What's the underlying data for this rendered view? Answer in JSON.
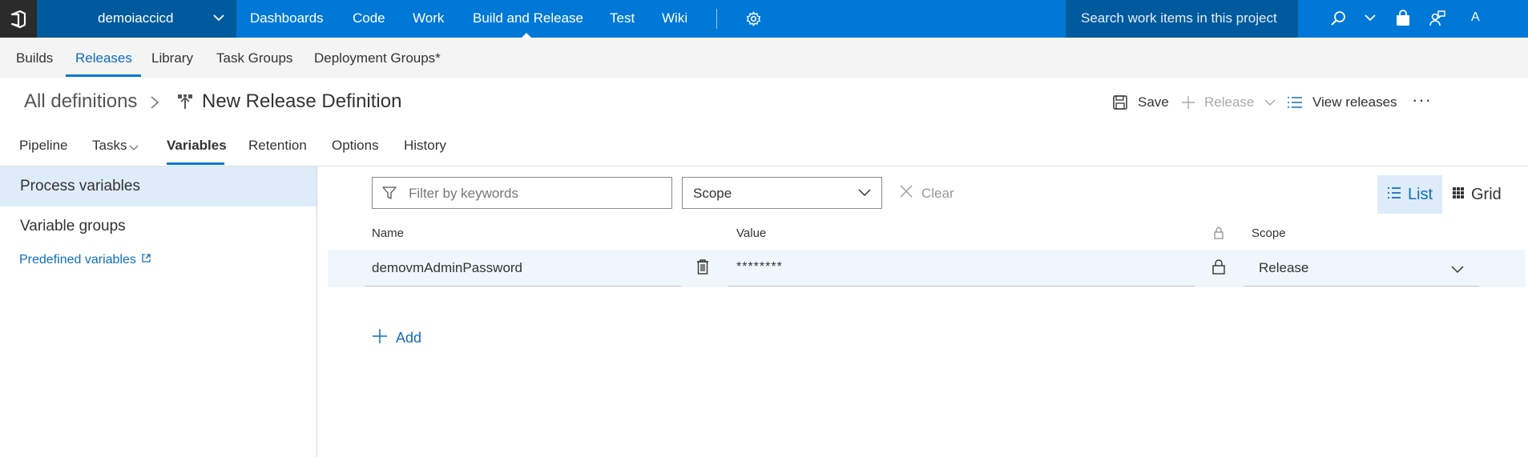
{
  "topbar": {
    "project": "demoiaccicd",
    "hubs": [
      "Dashboards",
      "Code",
      "Work",
      "Build and Release",
      "Test",
      "Wiki"
    ],
    "search_placeholder": "Search work items in this project",
    "avatar_initial": "A"
  },
  "subnav": {
    "items": [
      "Builds",
      "Releases",
      "Library",
      "Task Groups",
      "Deployment Groups*"
    ],
    "active": "Releases"
  },
  "header": {
    "breadcrumb": "All definitions",
    "title": "New Release Definition",
    "save_label": "Save",
    "release_label": "Release",
    "view_releases_label": "View releases",
    "more_label": "···"
  },
  "tabs": {
    "items": [
      "Pipeline",
      "Tasks",
      "Variables",
      "Retention",
      "Options",
      "History"
    ],
    "active": "Variables"
  },
  "left_panel": {
    "process_variables": "Process variables",
    "variable_groups": "Variable groups",
    "predefined_variables": "Predefined variables"
  },
  "toolbar": {
    "filter_placeholder": "Filter by keywords",
    "scope_label": "Scope",
    "clear_label": "Clear",
    "list_label": "List",
    "grid_label": "Grid"
  },
  "table": {
    "columns": {
      "name": "Name",
      "value": "Value",
      "scope": "Scope"
    },
    "rows": [
      {
        "name": "demovmAdminPassword",
        "value": "********",
        "scope": "Release",
        "secret": true
      }
    ],
    "add_label": "Add"
  },
  "colors": {
    "accent": "#0078d7",
    "accent_dark": "#005a9e",
    "selected_bg": "#deecf9",
    "link": "#106ebe"
  }
}
